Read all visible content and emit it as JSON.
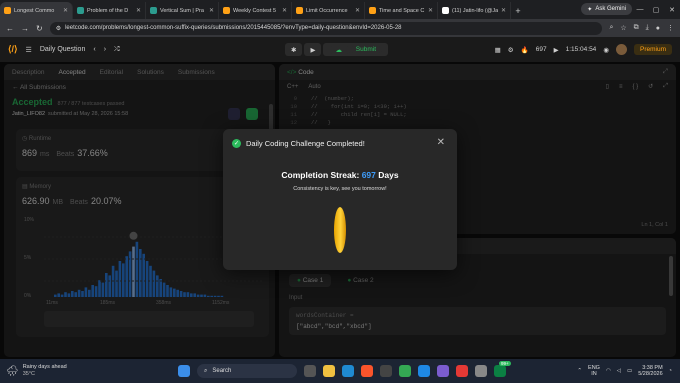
{
  "browser": {
    "tabs": [
      {
        "title": "Longest Commo",
        "color": "#ffa116",
        "active": true
      },
      {
        "title": "Problem of the D",
        "color": "#2c9c8f",
        "active": false
      },
      {
        "title": "Vertical Sum | Pra",
        "color": "#2c9c8f",
        "active": false
      },
      {
        "title": "Weekly Contest 5",
        "color": "#ffa116",
        "active": false
      },
      {
        "title": "Limit Occurrence",
        "color": "#ffa116",
        "active": false
      },
      {
        "title": "Time and Space C",
        "color": "#ffa116",
        "active": false
      },
      {
        "title": "(11) Jatin-lifo (@Ja",
        "color": "#ffffff",
        "active": false
      }
    ],
    "ask_gemini": "Ask Gemini",
    "url": "leetcode.com/problems/longest-common-suffix-queries/submissions/2015445085/?envType=daily-question&envId=2026-05-28"
  },
  "leetcode": {
    "problem_list": "Daily Question",
    "submit": "Submit",
    "coins": "697",
    "timer": "1:15:04:54",
    "premium": "Premium"
  },
  "left_panel": {
    "tabs": [
      "Description",
      "Accepted",
      "Editorial",
      "Solutions",
      "Submissions"
    ],
    "back": "All Submissions",
    "status": "Accepted",
    "testcases": "877 / 877 testcases passed",
    "user": "Jatin_LIFO82",
    "submitted": "submitted at May 28, 2026 15:58",
    "runtime_label": "Runtime",
    "runtime_value": "869",
    "runtime_unit": "ms",
    "runtime_beats_label": "Beats",
    "runtime_beats": "37.66%",
    "memory_label": "Memory",
    "memory_value": "626.90",
    "memory_unit": "MB",
    "memory_beats_label": "Beats",
    "memory_beats": "20.07%",
    "y_ticks": [
      "10%",
      "5%",
      "0%"
    ],
    "x_ticks": [
      "11ms",
      "185ms",
      "358ms",
      "1152ms"
    ]
  },
  "code_panel": {
    "title": "Code",
    "language": "C++",
    "auto": "Auto",
    "lines": [
      {
        "n": "9",
        "code": "//  (number);"
      },
      {
        "n": "10",
        "code": "//    for(int i=0; i<30; i++)"
      },
      {
        "n": "11",
        "code": "//       child ren[i] = NULL;"
      },
      {
        "n": "12",
        "code": "//   }"
      }
    ],
    "position": "Ln 1, Col 1"
  },
  "testcase_panel": {
    "case1": "Case 1",
    "case2": "Case 2",
    "input_label": "Input",
    "var_name": "wordsContainer =",
    "var_value": "[\"abcd\",\"bcd\",\"xbcd\"]"
  },
  "modal": {
    "title": "Daily Coding Challenge Completed!",
    "streak_label": "Completion Streak:",
    "streak_value": "697",
    "streak_unit": "Days",
    "message": "Consistency is key, see you tomorrow!"
  },
  "taskbar": {
    "weather_title": "Rainy days ahead",
    "weather_temp": "35°C",
    "search": "Search",
    "badge": "99+",
    "lang": "ENG",
    "lang_region": "IN",
    "time": "3:38 PM",
    "date": "5/28/2026"
  }
}
